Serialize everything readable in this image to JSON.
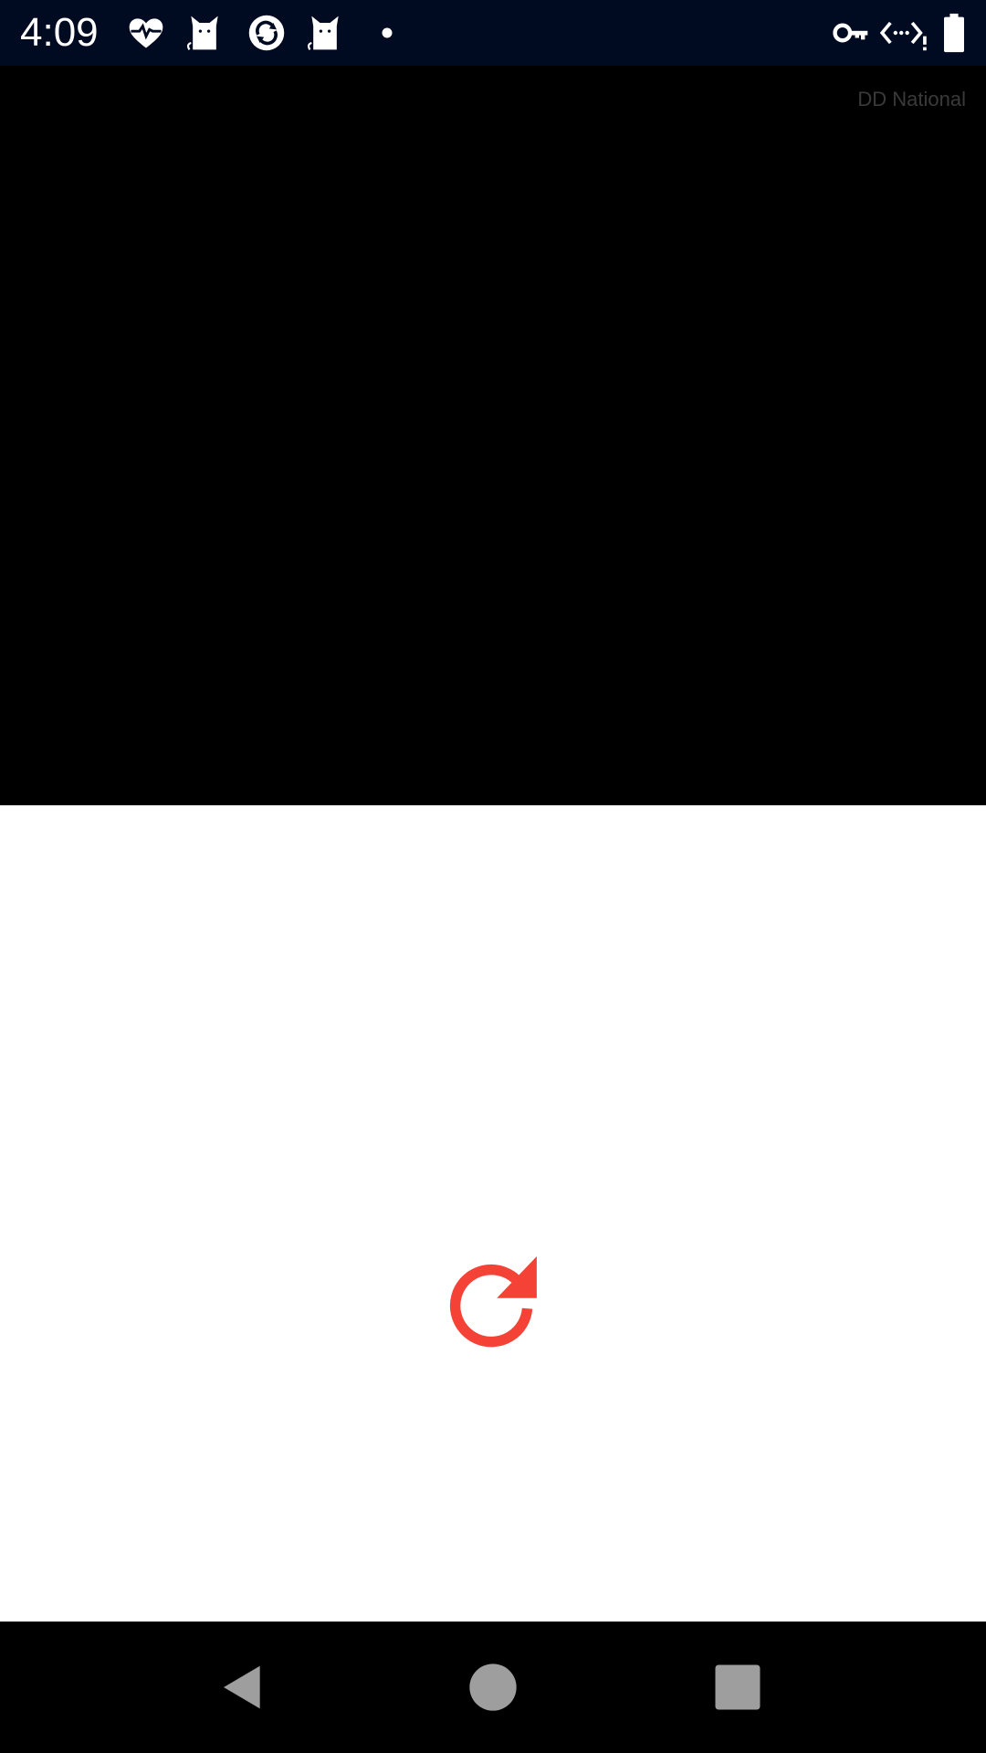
{
  "status_bar": {
    "time": "4:09",
    "background_color": "#000a20",
    "left_icons": [
      "heart-pulse-icon",
      "cat-icon",
      "sync-badge-icon",
      "cat-icon",
      "dot-icon"
    ],
    "right_icons": [
      "vpn-key-icon",
      "data-arrows-icon",
      "battery-icon"
    ]
  },
  "video": {
    "channel_watermark": "DD National",
    "background_color": "#000000"
  },
  "content": {
    "reload_icon": "refresh-icon",
    "accent_color": "#f44336"
  },
  "nav_bar": {
    "buttons": [
      "back-icon",
      "home-icon",
      "recents-icon"
    ],
    "button_color": "#9e9e9e"
  }
}
